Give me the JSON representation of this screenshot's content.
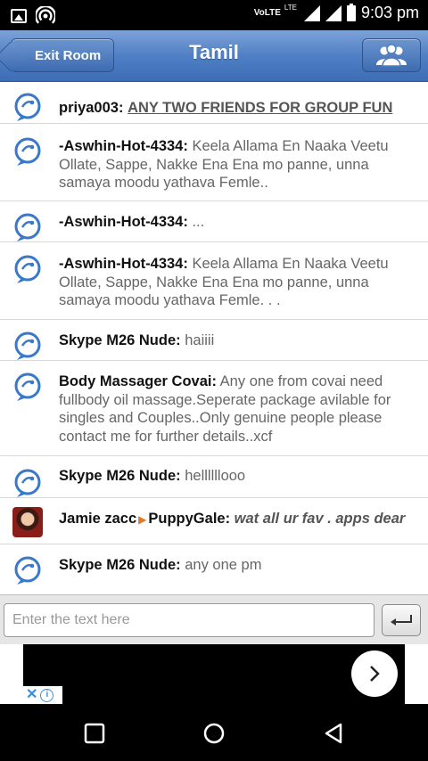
{
  "status_bar": {
    "volte": "VoLTE",
    "lte": "LTE",
    "time": "9:03 pm"
  },
  "header": {
    "exit_label": "Exit Room",
    "title": "Tamil"
  },
  "messages": [
    {
      "sender": "priya003:",
      "text": "ANY TWO FRIENDS FOR GROUP FUN",
      "style": "underline"
    },
    {
      "sender": "-Aswhin-Hot-4334:",
      "text": "Keela Allama En Naaka Veetu Ollate, Sappe, Nakke Ena Ena mo panne, unna samaya moodu yathava Femle..",
      "style": "normal"
    },
    {
      "sender": "-Aswhin-Hot-4334:",
      "text": "...",
      "style": "normal"
    },
    {
      "sender": "-Aswhin-Hot-4334:",
      "text": "Keela Allama En Naaka Veetu Ollate, Sappe, Nakke Ena Ena mo panne, unna samaya moodu yathava Femle. . .",
      "style": "normal"
    },
    {
      "sender": "Skype M26 Nude:",
      "text": "haiiii",
      "style": "normal"
    },
    {
      "sender": "Body Massager Covai:",
      "text": "Any one from covai need fullbody oil massage.Seperate package avilable for singles and Couples..Only genuine people please contact me for further details..xcf",
      "style": "normal"
    },
    {
      "sender": "Skype M26 Nude:",
      "text": "hellllllooo",
      "style": "normal"
    },
    {
      "sender": "Jamie zacc",
      "recipient": "PuppyGale:",
      "text": "wat all ur fav . apps dear",
      "style": "italic"
    },
    {
      "sender": "Skype M26 Nude:",
      "text": "any one pm",
      "style": "normal"
    }
  ],
  "input": {
    "placeholder": "Enter the text here"
  },
  "colors": {
    "header": "#4f7fc4",
    "icon_blue": "#3b78c8",
    "divider": "#d9d9d9"
  }
}
